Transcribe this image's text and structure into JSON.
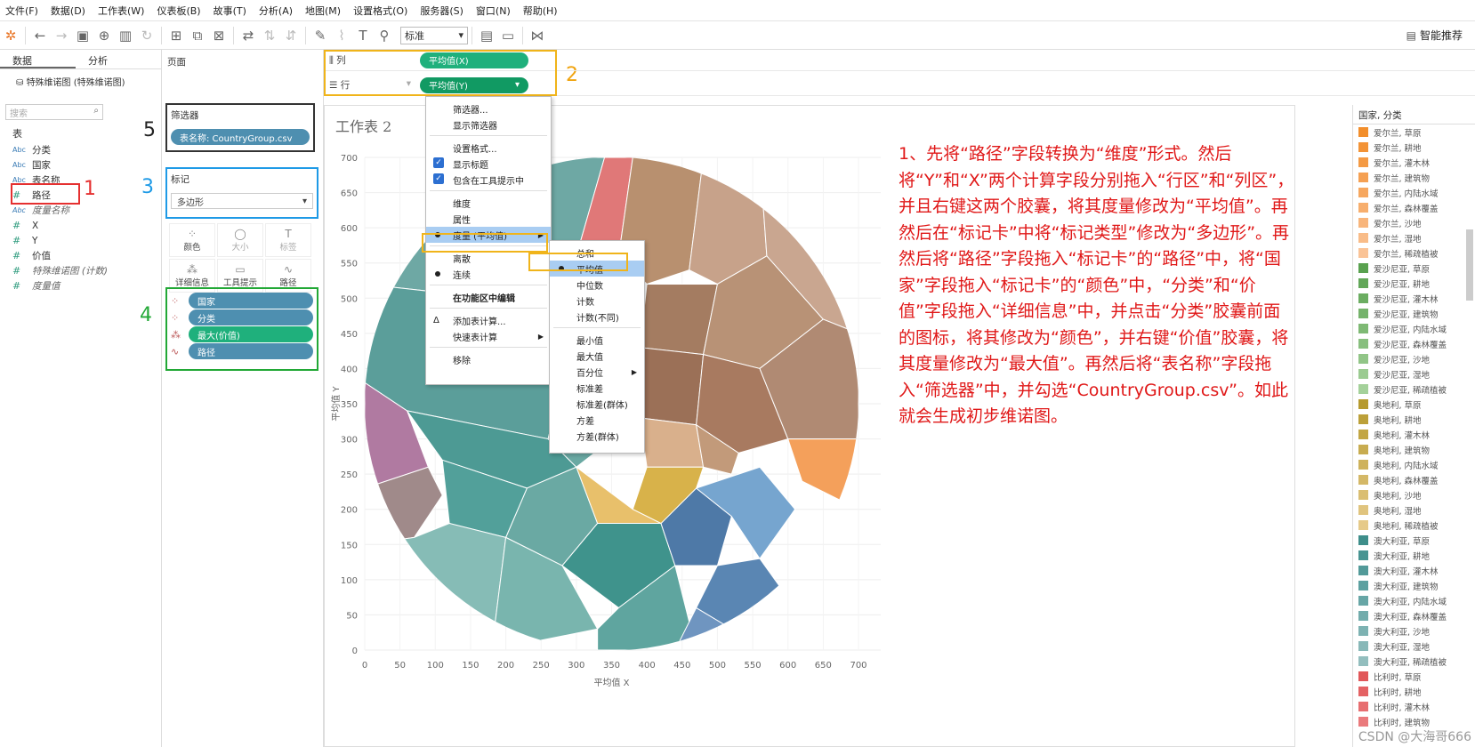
{
  "menubar": [
    "文件(F)",
    "数据(D)",
    "工作表(W)",
    "仪表板(B)",
    "故事(T)",
    "分析(A)",
    "地图(M)",
    "设置格式(O)",
    "服务器(S)",
    "窗口(N)",
    "帮助(H)"
  ],
  "toolbar": {
    "format_value": "标准",
    "smart": "智能推荐"
  },
  "left": {
    "tab_data": "数据",
    "tab_analysis": "分析",
    "datasource": "特殊维诺图 (特殊维诺图)",
    "search_placeholder": "搜索",
    "section": "表",
    "fields": [
      {
        "type": "Abc",
        "name": "分类"
      },
      {
        "type": "Abc",
        "name": "国家"
      },
      {
        "type": "Abc",
        "name": "表名称"
      },
      {
        "type": "#",
        "name": "路径"
      },
      {
        "type": "Abc",
        "name": "度量名称",
        "italic": true
      },
      {
        "type": "#",
        "name": "X"
      },
      {
        "type": "#",
        "name": "Y"
      },
      {
        "type": "#",
        "name": "价值"
      },
      {
        "type": "#",
        "name": "特殊维诺图 (计数)",
        "italic": true
      },
      {
        "type": "#",
        "name": "度量值",
        "italic": true
      }
    ]
  },
  "col2": {
    "pages": "页面",
    "filters": "筛选器",
    "filter_pill": "表名称: CountryGroup.csv",
    "marks": "标记",
    "mark_type": "多边形",
    "buttons": [
      {
        "icon": "⁘",
        "label": "颜色"
      },
      {
        "icon": "◯",
        "label": "大小"
      },
      {
        "icon": "T",
        "label": "标签"
      },
      {
        "icon": "⁂",
        "label": "详细信息"
      },
      {
        "icon": "▭",
        "label": "工具提示"
      },
      {
        "icon": "∿",
        "label": "路径"
      }
    ],
    "shelf_pills": [
      {
        "icon": "⁘",
        "label": "国家",
        "color": "blue"
      },
      {
        "icon": "⁘",
        "label": "分类",
        "color": "blue"
      },
      {
        "icon": "⁂",
        "label": "最大(价值)",
        "color": "green"
      },
      {
        "icon": "∿",
        "label": "路径",
        "color": "blue"
      }
    ]
  },
  "shelves": {
    "columns_label": "列",
    "columns_pill": "平均值(X)",
    "rows_label": "行",
    "rows_pill": "平均值(Y)"
  },
  "annotations": {
    "a1": "1",
    "a2": "2",
    "a3": "3",
    "a4": "4",
    "a5": "5"
  },
  "worksheet": {
    "title": "工作表 2",
    "instructions": "1、先将“路径”字段转换为“维度”形式。然后将“Y”和“X”两个计算字段分别拖入“行区”和“列区”，并且右键这两个胶囊，将其度量修改为“平均值”。再然后在“标记卡”中将“标记类型”修改为“多边形”。再然后将“路径”字段拖入“标记卡”的“路径”中，将“国家”字段拖入“标记卡”的“颜色”中，“分类”和“价值”字段拖入“详细信息”中，并点击“分类”胶囊前面的图标，将其修改为“颜色”，并右键“价值”胶囊，将其度量修改为“最大值”。再然后将“表名称”字段拖入“筛选器”中，并勾选“CountryGroup.csv”。如此就会生成初步维诺图。",
    "watermark": "CSDN @大海哥666"
  },
  "menu1": [
    {
      "label": "筛选器..."
    },
    {
      "label": "显示筛选器"
    },
    {
      "sep": true
    },
    {
      "label": "设置格式..."
    },
    {
      "label": "显示标题",
      "check": true
    },
    {
      "label": "包含在工具提示中",
      "check": true
    },
    {
      "sep": true
    },
    {
      "label": "维度"
    },
    {
      "label": "属性"
    },
    {
      "label": "度量 (平均值)",
      "dot": true,
      "arrow": true,
      "highlight": true
    },
    {
      "sep": true
    },
    {
      "label": "离散"
    },
    {
      "label": "连续",
      "dot": true
    },
    {
      "sep": true
    },
    {
      "label": "在功能区中编辑",
      "bold": true
    },
    {
      "sep": true
    },
    {
      "label": "添加表计算...",
      "delta": true
    },
    {
      "label": "快速表计算",
      "arrow": true
    },
    {
      "sep": true
    },
    {
      "label": "移除"
    }
  ],
  "menu2": [
    {
      "label": "总和"
    },
    {
      "label": "平均值",
      "dot": true,
      "highlight": true
    },
    {
      "label": "中位数"
    },
    {
      "label": "计数"
    },
    {
      "label": "计数(不同)"
    },
    {
      "sep": true
    },
    {
      "label": "最小值"
    },
    {
      "label": "最大值"
    },
    {
      "label": "百分位",
      "arrow": true
    },
    {
      "label": "标准差"
    },
    {
      "label": "标准差(群体)"
    },
    {
      "label": "方差"
    },
    {
      "label": "方差(群体)"
    }
  ],
  "legend": {
    "title": "国家, 分类",
    "items": [
      {
        "label": "爱尔兰, 草原",
        "color": "#f28e2b"
      },
      {
        "label": "爱尔兰, 耕地",
        "color": "#f39336"
      },
      {
        "label": "爱尔兰, 灌木林",
        "color": "#f49a44"
      },
      {
        "label": "爱尔兰, 建筑物",
        "color": "#f5a052"
      },
      {
        "label": "爱尔兰, 内陆水域",
        "color": "#f6a75f"
      },
      {
        "label": "爱尔兰, 森林覆盖",
        "color": "#f7ae6d"
      },
      {
        "label": "爱尔兰, 沙地",
        "color": "#f8b57b"
      },
      {
        "label": "爱尔兰, 湿地",
        "color": "#f9bc88"
      },
      {
        "label": "爱尔兰, 稀疏植被",
        "color": "#fac396"
      },
      {
        "label": "爱沙尼亚, 草原",
        "color": "#59a14f"
      },
      {
        "label": "爱沙尼亚, 耕地",
        "color": "#62a758"
      },
      {
        "label": "爱沙尼亚, 灌木林",
        "color": "#6bad61"
      },
      {
        "label": "爱沙尼亚, 建筑物",
        "color": "#75b36b"
      },
      {
        "label": "爱沙尼亚, 内陆水域",
        "color": "#7eb974"
      },
      {
        "label": "爱沙尼亚, 森林覆盖",
        "color": "#88bf7e"
      },
      {
        "label": "爱沙尼亚, 沙地",
        "color": "#91c587"
      },
      {
        "label": "爱沙尼亚, 湿地",
        "color": "#9bcb91"
      },
      {
        "label": "爱沙尼亚, 稀疏植被",
        "color": "#a4d19a"
      },
      {
        "label": "奥地利, 草原",
        "color": "#b69a2e"
      },
      {
        "label": "奥地利, 耕地",
        "color": "#bca039"
      },
      {
        "label": "奥地利, 灌木林",
        "color": "#c2a644"
      },
      {
        "label": "奥地利, 建筑物",
        "color": "#c8ac50"
      },
      {
        "label": "奥地利, 内陆水域",
        "color": "#ceb25b"
      },
      {
        "label": "奥地利, 森林覆盖",
        "color": "#d4b867"
      },
      {
        "label": "奥地利, 沙地",
        "color": "#dabe72"
      },
      {
        "label": "奥地利, 湿地",
        "color": "#e0c47e"
      },
      {
        "label": "奥地利, 稀疏植被",
        "color": "#e6ca89"
      },
      {
        "label": "澳大利亚, 草原",
        "color": "#3e8e8a"
      },
      {
        "label": "澳大利亚, 耕地",
        "color": "#489492"
      },
      {
        "label": "澳大利亚, 灌木林",
        "color": "#529a99"
      },
      {
        "label": "澳大利亚, 建筑物",
        "color": "#5ca0a0"
      },
      {
        "label": "澳大利亚, 内陆水域",
        "color": "#67a6a6"
      },
      {
        "label": "澳大利亚, 森林覆盖",
        "color": "#72acac"
      },
      {
        "label": "澳大利亚, 沙地",
        "color": "#7db2b2"
      },
      {
        "label": "澳大利亚, 湿地",
        "color": "#88b8b8"
      },
      {
        "label": "澳大利亚, 稀疏植被",
        "color": "#93bebe"
      },
      {
        "label": "比利时, 草原",
        "color": "#e15759"
      },
      {
        "label": "比利时, 耕地",
        "color": "#e46264"
      },
      {
        "label": "比利时, 灌木林",
        "color": "#e76e70"
      },
      {
        "label": "比利时, 建筑物",
        "color": "#ea7a7c"
      }
    ]
  },
  "chart_data": {
    "type": "scatter",
    "title": "工作表 2",
    "xlabel": "平均值 X",
    "ylabel": "平均值 Y",
    "xlim": [
      0,
      700
    ],
    "ylim": [
      0,
      700
    ],
    "x_ticks": [
      0,
      50,
      100,
      150,
      200,
      250,
      300,
      350,
      400,
      450,
      500,
      550,
      600,
      650,
      700
    ],
    "y_ticks": [
      0,
      50,
      100,
      150,
      200,
      250,
      300,
      350,
      400,
      450,
      500,
      550,
      600,
      650,
      700
    ],
    "note_shape": "voronoi polygons within circle"
  }
}
